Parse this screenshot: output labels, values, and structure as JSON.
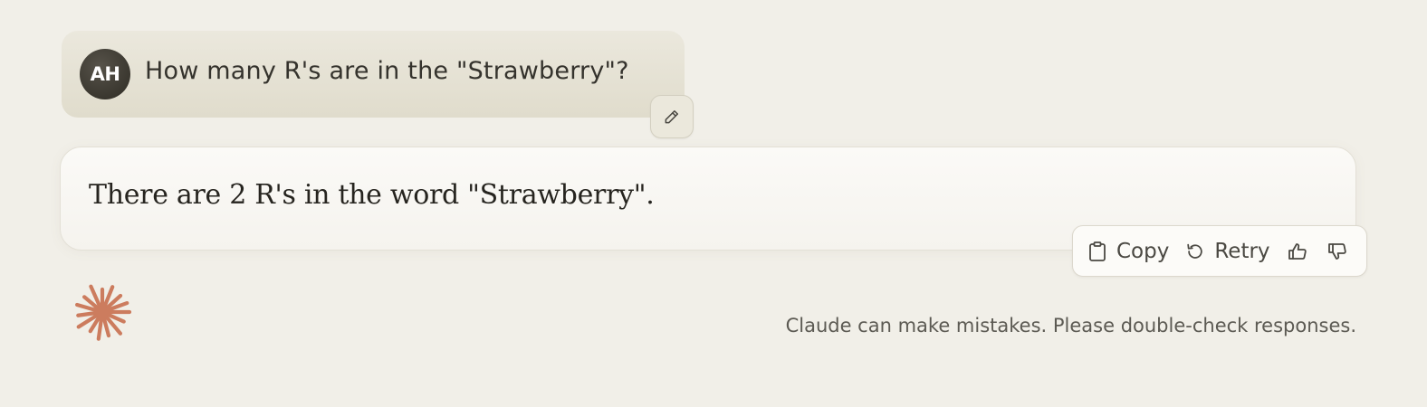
{
  "conversation": {
    "user_message": {
      "avatar_initials": "AH",
      "text": "How many R's are in the \"Strawberry\"?",
      "edit_icon": "pencil-icon"
    },
    "assistant_message": {
      "text": "There are 2 R's in the word \"Strawberry\"."
    },
    "actions": {
      "copy_label": "Copy",
      "copy_icon": "clipboard-icon",
      "retry_label": "Retry",
      "retry_icon": "retry-icon",
      "thumbs_up_icon": "thumbs-up-icon",
      "thumbs_down_icon": "thumbs-down-icon"
    }
  },
  "footer": {
    "logo_icon": "claude-starburst-icon",
    "disclaimer": "Claude can make mistakes. Please double-check responses."
  },
  "colors": {
    "background": "#f1efe8",
    "user_bubble": "#e5e2d5",
    "avatar": "#3f3c34",
    "assistant_bubble": "#f9f8f4",
    "logo_accent": "#cc7c5e"
  }
}
